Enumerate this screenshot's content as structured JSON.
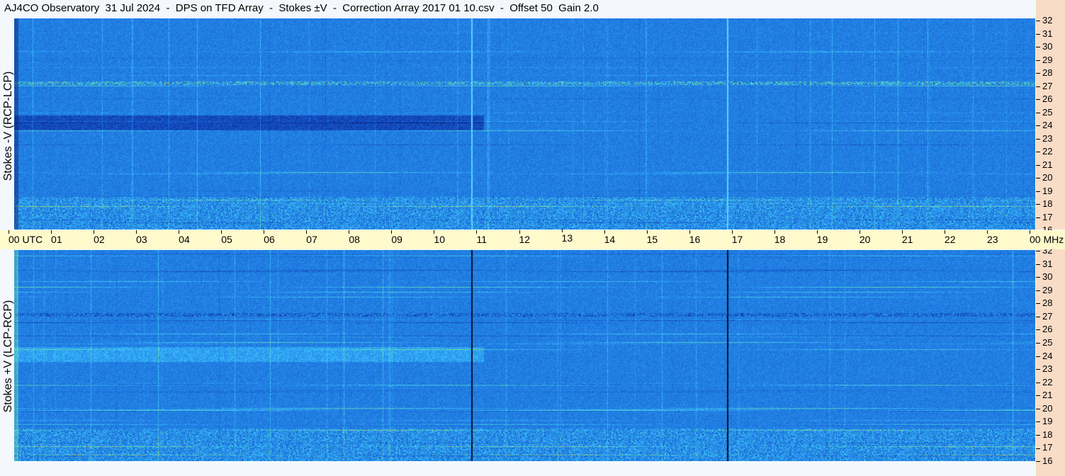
{
  "title": "AJ4CO Observatory  31 Jul 2024  -  DPS on TFD Array  -  Stokes ±V  -  Correction Array 2017 01 10.csv  -  Offset 50  Gain 2.0",
  "panels": {
    "top": {
      "label": "Stokes -V (RCP-LCP)"
    },
    "bottom": {
      "label": "Stokes +V (LCP-RCP)"
    }
  },
  "time_axis": {
    "ticks": [
      "00 UTC",
      "01",
      "02",
      "03",
      "04",
      "05",
      "06",
      "07",
      "08",
      "09",
      "10",
      "11",
      "12",
      "13",
      "14",
      "15",
      "16",
      "17",
      "18",
      "19",
      "20",
      "21",
      "22",
      "23",
      "00 MHz"
    ]
  },
  "freq_axis": {
    "ticks": [
      "32",
      "31",
      "30",
      "29",
      "28",
      "27",
      "26",
      "25",
      "24",
      "23",
      "22",
      "21",
      "20",
      "19",
      "18",
      "17",
      "16"
    ]
  },
  "colors": {
    "background_blue": "#1a6fd8",
    "dark_blue": "#0a1f6e",
    "light_cyan": "#3cc9ff",
    "green": "#6cdc8c",
    "yellow": "#e8e05c",
    "red": "#e04020",
    "freq_axis_bg": "#f8dcc6",
    "time_axis_bg": "#fffacc"
  },
  "chart_data": {
    "type": "heatmap",
    "title": "AJ4CO Observatory  31 Jul 2024  -  DPS on TFD Array  -  Stokes ±V  -  Correction Array 2017 01 10.csv  -  Offset 50  Gain 2.0",
    "x_axis": {
      "unit": "UTC",
      "range": [
        0,
        24
      ],
      "ticks": [
        "00 UTC",
        "01",
        "02",
        "03",
        "04",
        "05",
        "06",
        "07",
        "08",
        "09",
        "10",
        "11",
        "12",
        "13",
        "14",
        "15",
        "16",
        "17",
        "18",
        "19",
        "20",
        "21",
        "22",
        "23",
        "00"
      ]
    },
    "y_axis": {
      "unit": "MHz",
      "range": [
        16,
        32
      ],
      "ticks": [
        32,
        31,
        30,
        29,
        28,
        27,
        26,
        25,
        24,
        23,
        22,
        21,
        20,
        19,
        18,
        17,
        16
      ]
    },
    "series": [
      {
        "name": "Stokes -V (RCP-LCP)"
      },
      {
        "name": "Stokes +V (LCP-RCP)"
      }
    ],
    "features": {
      "vertical_lines_utc": [
        10.75,
        16.75
      ],
      "strong_band_mhz": 27.1
    }
  }
}
